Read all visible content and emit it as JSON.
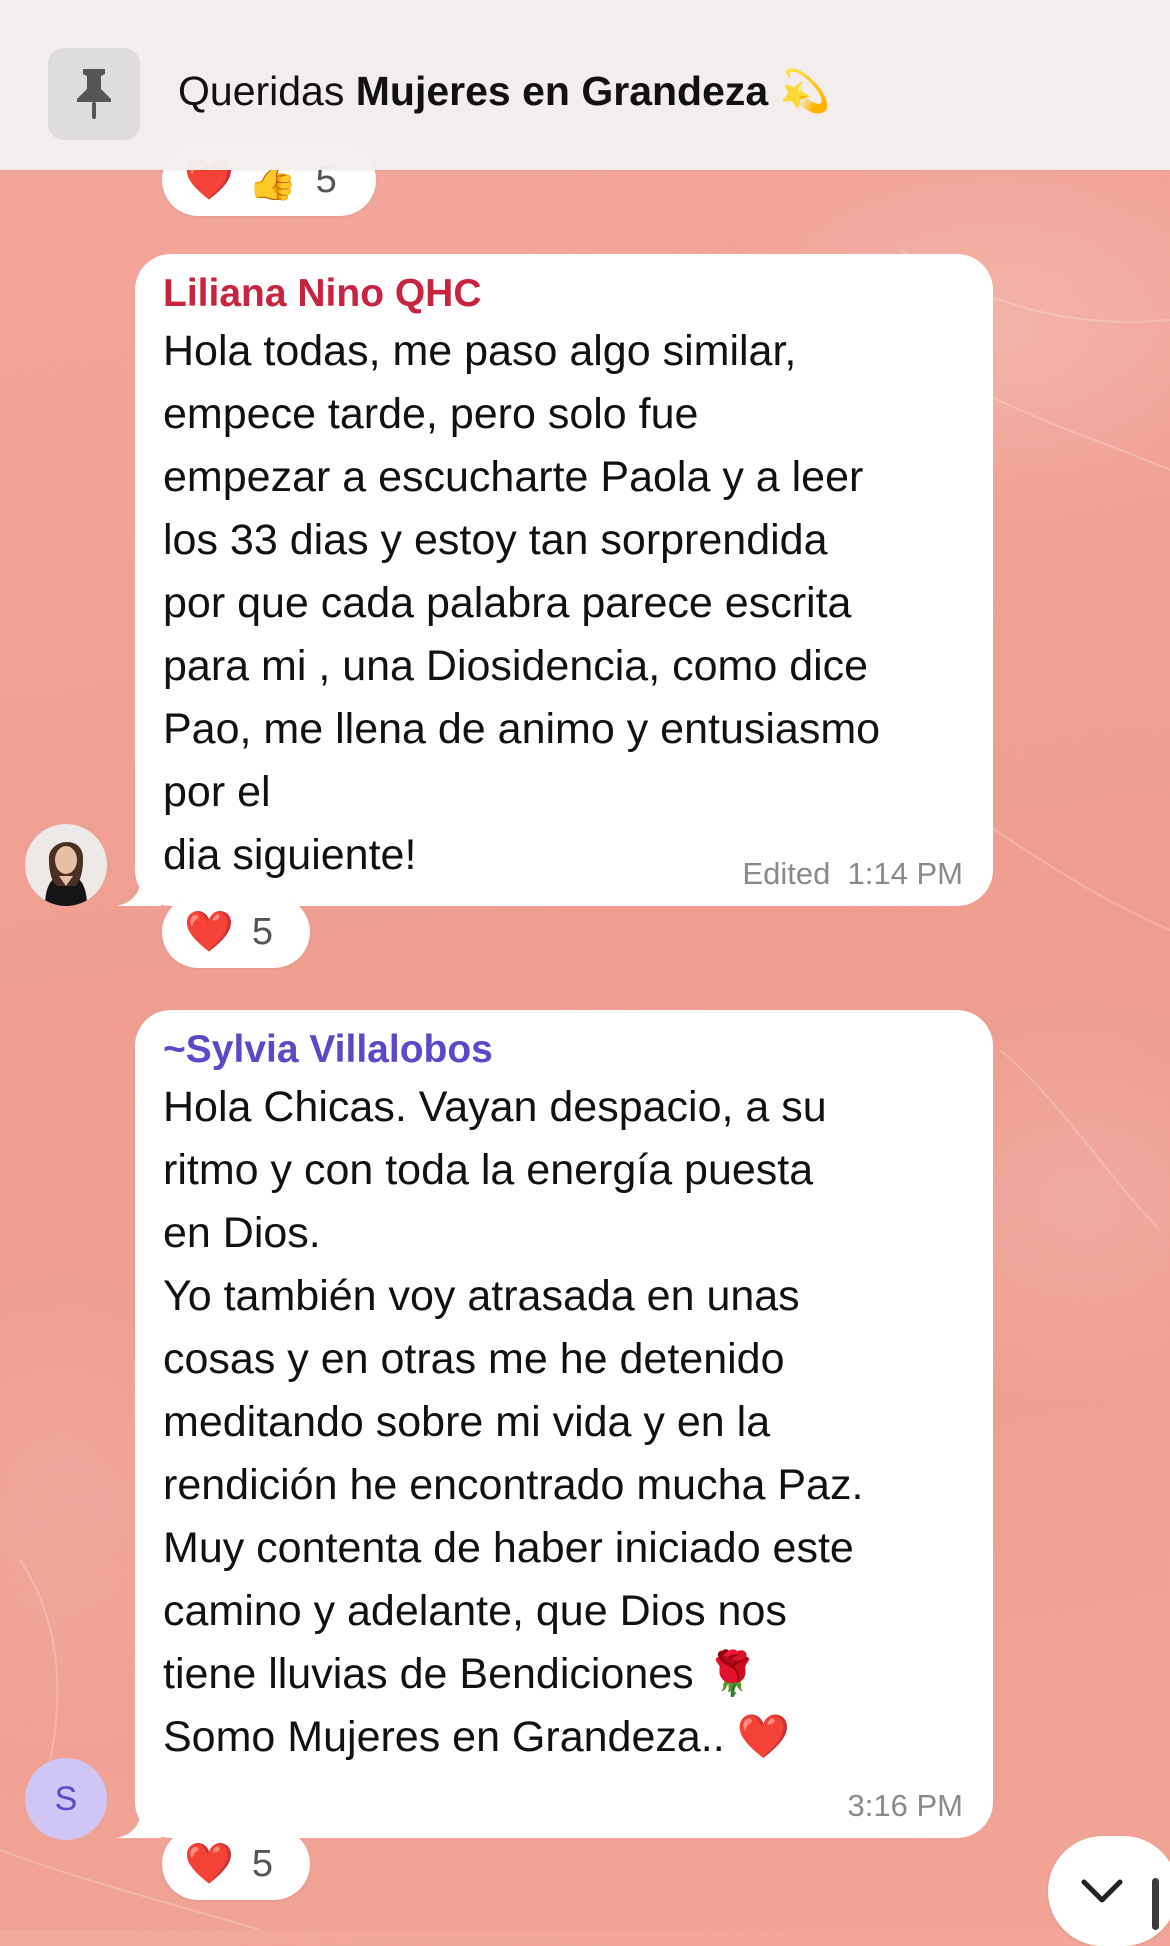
{
  "colors": {
    "pinned_background": "#f4f0f0",
    "liliana_name": "#c8233f",
    "sylvia_name": "#5b49c7",
    "avatar_letter_bg": "#cfc6f5"
  },
  "pinned": {
    "icon": "pin-icon",
    "title_prefix": "Queridas ",
    "title_bold": "Mujeres en Grandeza",
    "title_emoji": "💫"
  },
  "top_reactions": {
    "emojis": [
      "❤️",
      "👍"
    ],
    "count": "5"
  },
  "messages": [
    {
      "sender": "Liliana Nino QHC",
      "text": "Hola todas, me paso algo similar,\nempece tarde, pero solo fue\nempezar a escucharte Paola y a leer\nlos 33 dias y estoy tan sorprendida\npor que cada palabra parece escrita\npara mi , una Diosidencia, como dice\nPao, me llena de animo y entusiasmo\npor el\ndia siguiente!",
      "edited": "Edited",
      "time": "1:14 PM",
      "reaction_emoji": "❤️",
      "reaction_count": "5",
      "avatar": "profile-photo"
    },
    {
      "sender_prefix": "~",
      "sender": "Sylvia Villalobos",
      "text": "Hola Chicas. Vayan despacio, a su\nritmo y con toda la energía puesta\nen Dios.\nYo también voy atrasada en unas\ncosas y en otras me he detenido\nmeditando sobre mi vida y en la\nrendición he encontrado mucha Paz.\nMuy contenta de haber iniciado este\ncamino y adelante, que Dios nos\ntiene lluvias de Bendiciones 🌹\nSomo Mujeres en Grandeza.. ❤️",
      "time": "3:16 PM",
      "reaction_emoji": "❤️",
      "reaction_count": "5",
      "avatar_letter": "S"
    }
  ],
  "scroll_button": {
    "icon": "chevron-down-icon"
  }
}
